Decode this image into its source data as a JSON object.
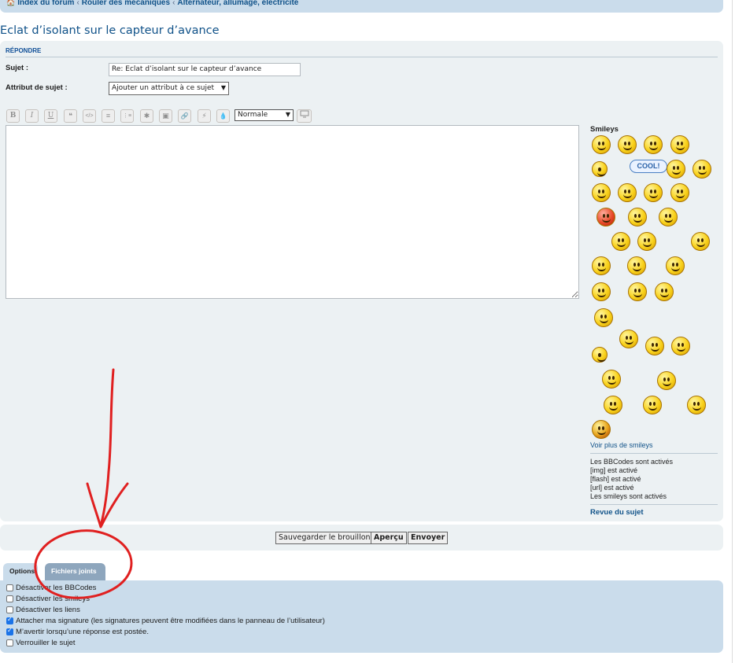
{
  "breadcrumbs": [
    "Index du forum",
    "Rouler des mécaniques",
    "Alternateur, allumage, électricité"
  ],
  "page_title": "Eclat d’isolant sur le capteur d’avance",
  "form": {
    "section_label": "RÉPONDRE",
    "subject_label": "Sujet :",
    "subject_value": "Re: Eclat d’isolant sur le capteur d’avance",
    "attr_label": "Attribut de sujet :",
    "attr_selected": "Ajouter un attribut à ce sujet",
    "font_size_selected": "Normale"
  },
  "toolbar": [
    "B",
    "I",
    "U",
    "❝",
    "</>",
    "≡",
    "⋮≡",
    "✱",
    "▣",
    "🔗",
    "⚡",
    "💧"
  ],
  "sidebar": {
    "smileys_title": "Smileys",
    "cool_label": "COOL!",
    "more_smileys": "Voir plus de smileys",
    "bbcode_info": [
      "Les BBCodes sont activés",
      "[img] est activé",
      "[flash] est activé",
      "[url] est activé",
      "Les smileys sont activés"
    ],
    "topic_review": "Revue du sujet"
  },
  "buttons": {
    "save_draft": "Sauvegarder le brouillon",
    "preview": "Aperçu",
    "submit": "Envoyer"
  },
  "tabs": {
    "options": "Options",
    "attachments": "Fichiers joints"
  },
  "options": [
    {
      "label": "Désactiver les BBCodes",
      "checked": false
    },
    {
      "label": "Désactiver les smileys",
      "checked": false
    },
    {
      "label": "Désactiver les liens",
      "checked": false
    },
    {
      "label": "Attacher ma signature (les signatures peuvent être modifiées dans le panneau de l’utilisateur)",
      "checked": true
    },
    {
      "label": "M’avertir lorsqu’une réponse est postée.",
      "checked": true
    },
    {
      "label": "Verrouiller le sujet",
      "checked": false
    }
  ],
  "annotation_color": "#e02020"
}
